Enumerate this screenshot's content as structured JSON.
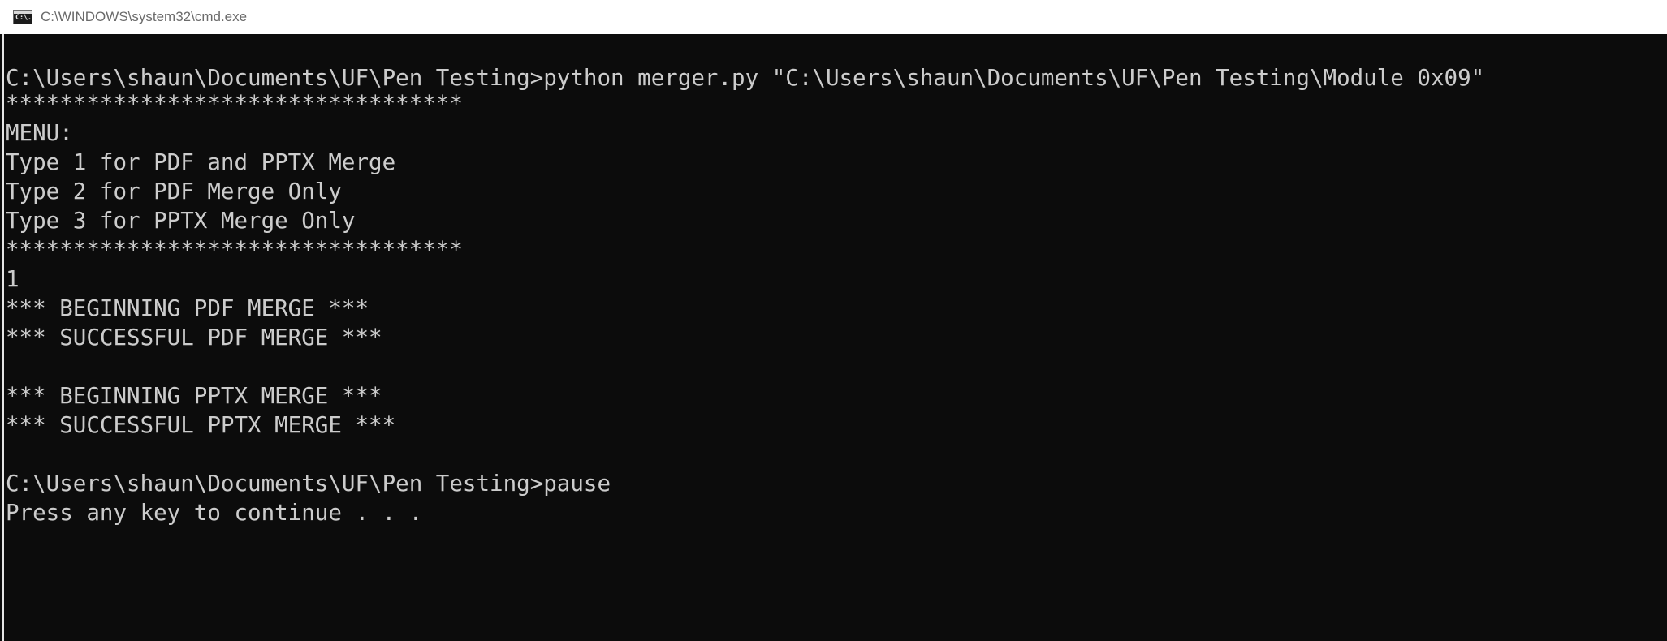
{
  "window": {
    "title": "C:\\WINDOWS\\system32\\cmd.exe",
    "icon_text": "C:\\."
  },
  "console": {
    "lines": [
      "C:\\Users\\shaun\\Documents\\UF\\Pen Testing>python merger.py \"C:\\Users\\shaun\\Documents\\UF\\Pen Testing\\Module 0x09\"",
      "**********************************",
      "MENU:",
      "Type 1 for PDF and PPTX Merge",
      "Type 2 for PDF Merge Only",
      "Type 3 for PPTX Merge Only",
      "**********************************",
      "1",
      "*** BEGINNING PDF MERGE ***",
      "*** SUCCESSFUL PDF MERGE ***",
      "*** BEGINNING PPTX MERGE ***",
      "*** SUCCESSFUL PPTX MERGE ***",
      "C:\\Users\\shaun\\Documents\\UF\\Pen Testing>pause",
      "Press any key to continue . . ."
    ]
  },
  "colors": {
    "console_background": "#0c0c0c",
    "console_text": "#cccccc",
    "titlebar_background": "#ffffff",
    "titlebar_text": "#6b6b6b"
  }
}
